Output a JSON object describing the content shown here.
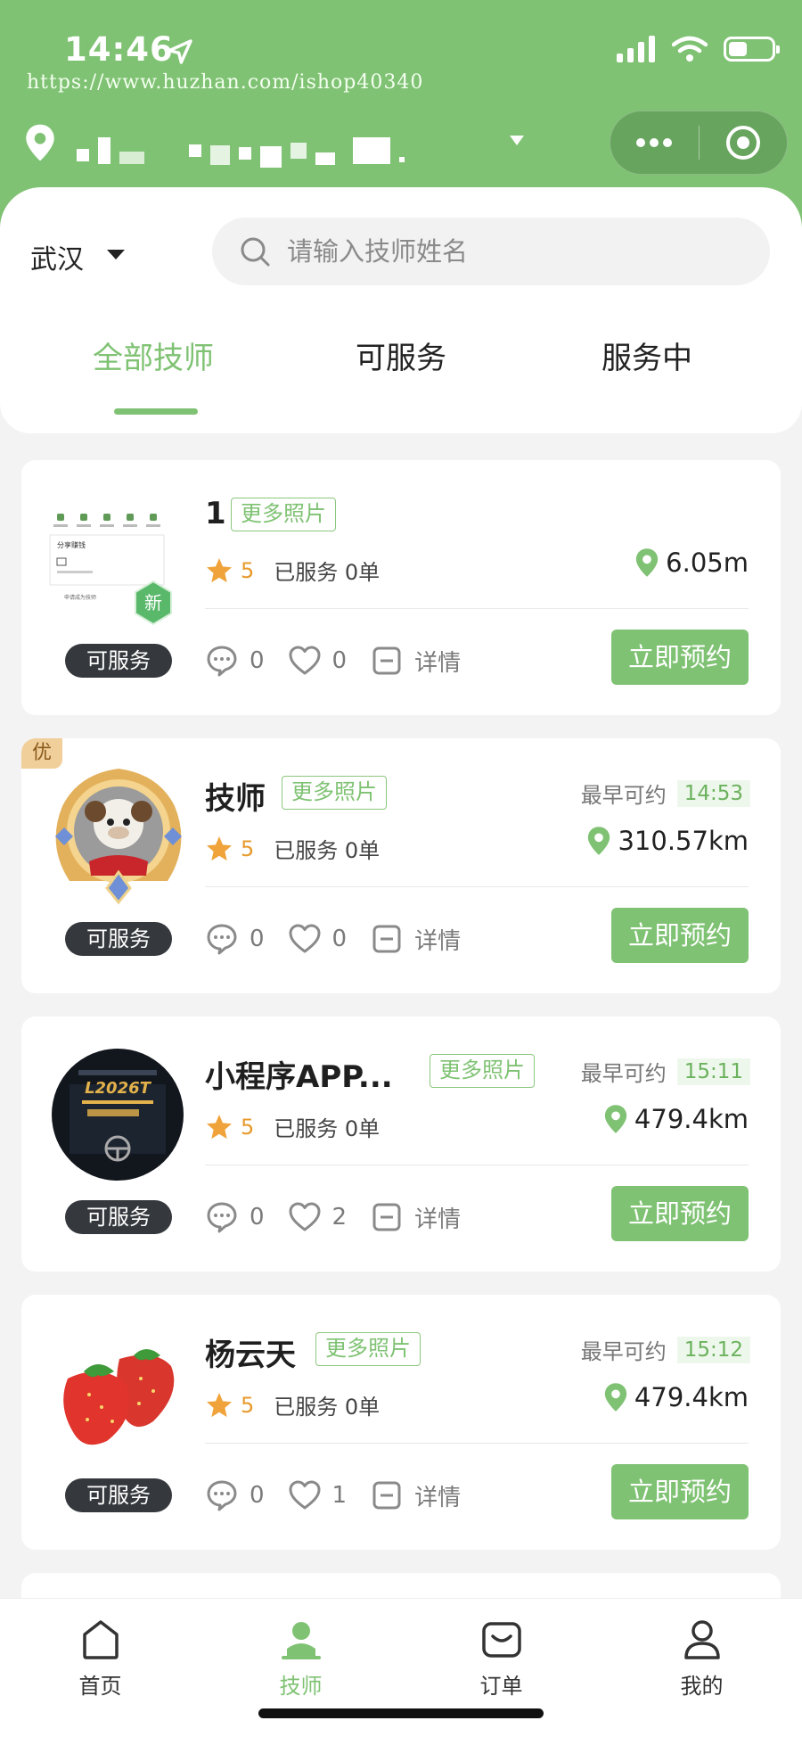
{
  "status_bar": {
    "time": "14:46",
    "watermark": "https://www.huzhan.com/ishop40340"
  },
  "header": {
    "city": "武汉",
    "search_placeholder": "请输入技师姓名"
  },
  "tabs": [
    {
      "label": "全部技师",
      "active": true
    },
    {
      "label": "可服务",
      "active": false
    },
    {
      "label": "服务中",
      "active": false
    }
  ],
  "labels": {
    "more_photos": "更多照片",
    "available": "可服务",
    "earliest": "最早可约",
    "book": "立即预约",
    "details": "详情",
    "new_badge": "新",
    "excellent_badge": "优"
  },
  "technicians": [
    {
      "name": "1",
      "rating": "5",
      "served": "已服务 0单",
      "distance": "6.05m",
      "earliest_time": "",
      "comments": "0",
      "likes": "0"
    },
    {
      "name": "技师",
      "rating": "5",
      "served": "已服务 0单",
      "distance": "310.57km",
      "earliest_time": "14:53",
      "comments": "0",
      "likes": "0"
    },
    {
      "name": "小程序APP...",
      "rating": "5",
      "served": "已服务 0单",
      "distance": "479.4km",
      "earliest_time": "15:11",
      "comments": "0",
      "likes": "2"
    },
    {
      "name": "杨云天",
      "rating": "5",
      "served": "已服务 0单",
      "distance": "479.4km",
      "earliest_time": "15:12",
      "comments": "0",
      "likes": "1"
    }
  ],
  "thumbnail_texts": {
    "app_screen_title": "分享赚钱",
    "app_screen_note": "申请成为技师",
    "car_logo": "L2026T"
  },
  "tabbar": [
    {
      "label": "首页",
      "icon": "home-icon",
      "active": false
    },
    {
      "label": "技师",
      "icon": "technician-icon",
      "active": true
    },
    {
      "label": "订单",
      "icon": "order-icon",
      "active": false
    },
    {
      "label": "我的",
      "icon": "profile-icon",
      "active": false
    }
  ],
  "colors": {
    "brand": "#7fc273",
    "badge_dark": "#35393d",
    "rating": "#e79a2c"
  }
}
